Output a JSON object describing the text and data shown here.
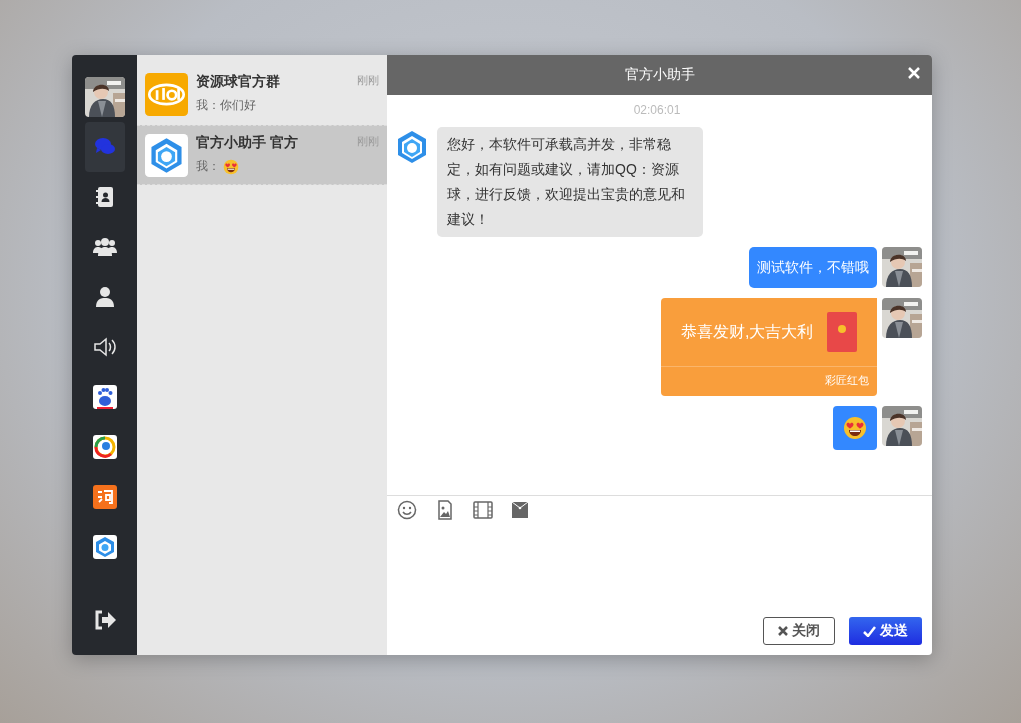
{
  "sidebar": {
    "items": [
      {
        "kind": "chat",
        "selected": true
      },
      {
        "kind": "contacts",
        "selected": false
      },
      {
        "kind": "group",
        "selected": false
      },
      {
        "kind": "user",
        "selected": false
      },
      {
        "kind": "speaker",
        "selected": false
      },
      {
        "kind": "baidu",
        "selected": false
      },
      {
        "kind": "tencent",
        "selected": false
      },
      {
        "kind": "taobao",
        "selected": false
      },
      {
        "kind": "hexagon",
        "selected": false
      }
    ]
  },
  "conversations": [
    {
      "kind": "itel",
      "name": "资源球官方群",
      "time": "刚刚",
      "preview": "我：你们好",
      "preview_emoji": false,
      "selected": false
    },
    {
      "kind": "hexagon",
      "name": "官方小助手 官方",
      "time": "刚刚",
      "preview": "我：",
      "preview_emoji": true,
      "selected": true
    }
  ],
  "chat": {
    "title": "官方小助手",
    "timestamp": "02:06:01",
    "messages": [
      {
        "kind": "text",
        "outgoing": false,
        "text": "您好，本软件可承载高并发，非常稳定，如有问题或建议，请加QQ：资源球，进行反馈，欢迎提出宝贵的意见和建议！"
      },
      {
        "kind": "text",
        "outgoing": true,
        "text": "测试软件，不错哦"
      },
      {
        "kind": "red_packet",
        "outgoing": true,
        "text": "恭喜发财,大吉大利",
        "footer": "彩匠红包"
      },
      {
        "kind": "emoji",
        "outgoing": true
      }
    ],
    "buttons": {
      "close": "关闭",
      "send": "发送"
    }
  }
}
